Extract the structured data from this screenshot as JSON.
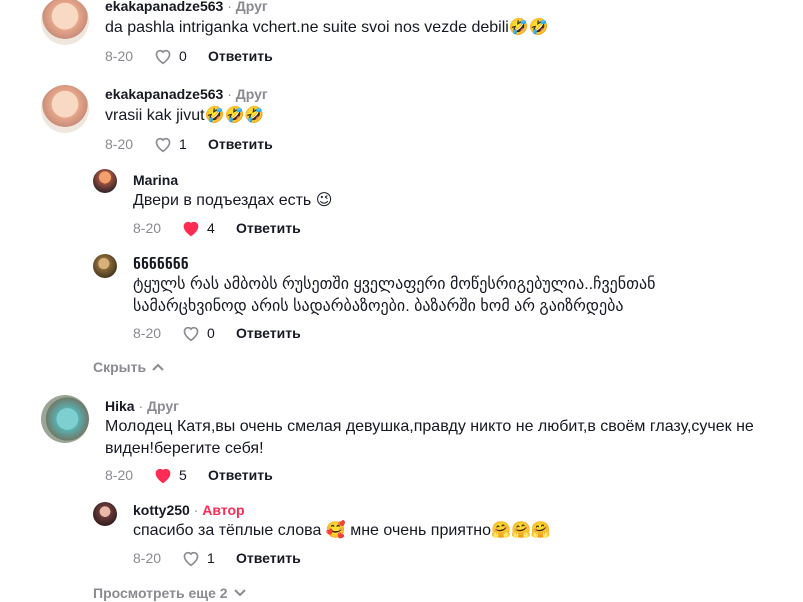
{
  "comments": [
    {
      "username": "ekakapanadze563",
      "tag": "Друг",
      "text": "da pashla intriganka vchert.ne suite svoi nos vezde debili",
      "emojis": "🤣🤣",
      "date": "8-20",
      "likes": "0",
      "liked": false,
      "reply_label": "Ответить"
    },
    {
      "username": "ekakapanadze563",
      "tag": "Друг",
      "text": "vrasii kak jivut",
      "emojis": "🤣🤣🤣",
      "date": "8-20",
      "likes": "1",
      "liked": false,
      "reply_label": "Ответить"
    },
    {
      "username": "Marina",
      "tag": "",
      "text": "Двери в подъездах есть",
      "emojis": "😉",
      "date": "8-20",
      "likes": "4",
      "liked": true,
      "reply_label": "Ответить"
    },
    {
      "username": "ნნნნნნნ",
      "tag": "",
      "text": "ტყულს რას ამბობს რუსეთში ყველაფერი მოწესრიგებულია..ჩვენთან სამარცხვინოდ არის სადარბაზოები. ბაზარში ხომ არ გაიზრდება",
      "emojis": "",
      "date": "8-20",
      "likes": "0",
      "liked": false,
      "reply_label": "Ответить"
    },
    {
      "username": "Hika",
      "tag": "Друг",
      "text": "Молодец Катя,вы очень смелая девушка,правду никто не любит,в своём глазу,сучек не виден!берегите себя!",
      "emojis": "",
      "date": "8-20",
      "likes": "5",
      "liked": true,
      "reply_label": "Ответить"
    },
    {
      "username": "kotty250",
      "tag": "Автор",
      "text": "спасибо за тёплые слова",
      "text_after": "мне очень приятно",
      "emoji_mid": "🥰",
      "emojis": "🤗🤗🤗",
      "date": "8-20",
      "likes": "1",
      "liked": false,
      "reply_label": "Ответить"
    }
  ],
  "hide_label": "Скрыть",
  "more_label": "Просмотреть еще 2",
  "colors": {
    "accent": "#fe2c55",
    "muted": "#8a8b91",
    "text": "#161823"
  },
  "icons": {
    "like": "heart-icon",
    "hide": "chevron-up-icon",
    "more": "chevron-down-icon"
  }
}
